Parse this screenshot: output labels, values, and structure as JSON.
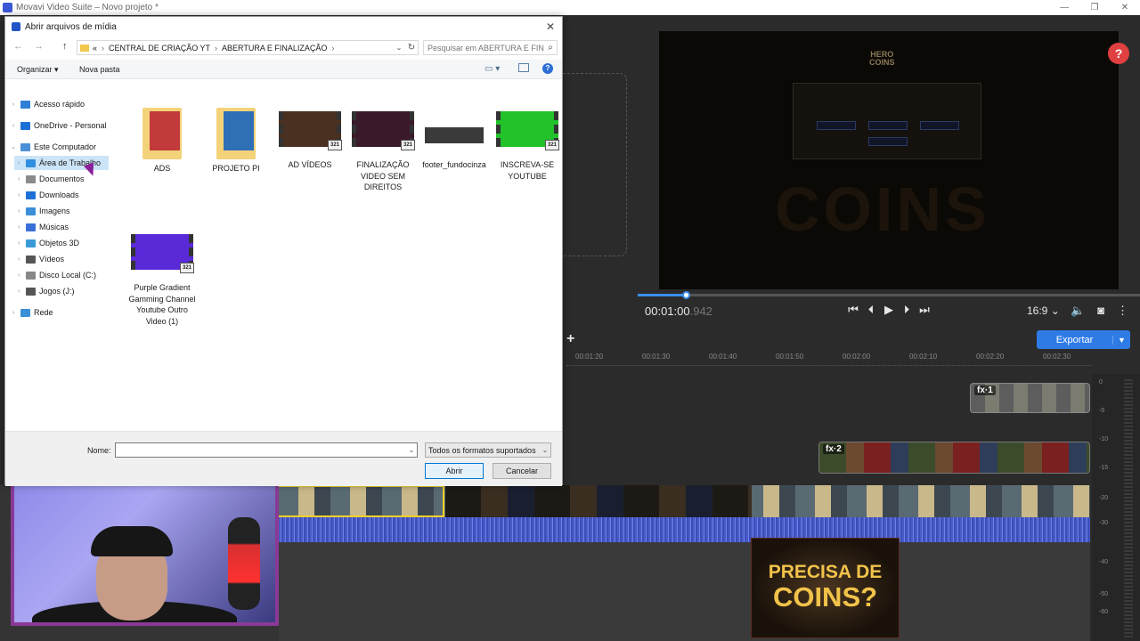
{
  "app": {
    "title": "Movavi Video Suite – Novo projeto *",
    "window_controls": [
      "—",
      "❐",
      "✕"
    ]
  },
  "dialog": {
    "title": "Abrir arquivos de mídia",
    "close": "✕",
    "nav": {
      "back": "←",
      "forward": "→",
      "up": "↑"
    },
    "breadcrumb": [
      "CENTRAL DE CRIAÇÃO YT",
      "ABERTURA E FINALIZAÇÃO"
    ],
    "breadcrumb_prefix": "«",
    "breadcrumb_sep": "›",
    "search_placeholder": "Pesquisar em ABERTURA E FIN...",
    "toolbar": {
      "organize": "Organizar ▾",
      "new_folder": "Nova pasta",
      "help": "?"
    },
    "nav_pane": [
      {
        "label": "Acesso rápido",
        "icon": "star-icon",
        "color": "#2f7fd6",
        "indent": 0,
        "chev": "›"
      },
      {
        "label": "OneDrive - Personal",
        "icon": "cloud-icon",
        "color": "#1d6fd8",
        "indent": 0,
        "chev": "›"
      },
      {
        "label": "Este Computador",
        "icon": "computer-icon",
        "color": "#4a90d9",
        "indent": 0,
        "chev": "⌄"
      },
      {
        "label": "Área de Trabalho",
        "icon": "desktop-icon",
        "color": "#2f8fe0",
        "indent": 1,
        "chev": "›",
        "selected": true
      },
      {
        "label": "Documentos",
        "icon": "documents-icon",
        "color": "#8a8a8a",
        "indent": 1,
        "chev": "›"
      },
      {
        "label": "Downloads",
        "icon": "download-icon",
        "color": "#1d6fd8",
        "indent": 1,
        "chev": "›"
      },
      {
        "label": "Imagens",
        "icon": "images-icon",
        "color": "#3a8fd8",
        "indent": 1,
        "chev": "›"
      },
      {
        "label": "Músicas",
        "icon": "music-icon",
        "color": "#3a6fd8",
        "indent": 1,
        "chev": "›"
      },
      {
        "label": "Objetos 3D",
        "icon": "cube-icon",
        "color": "#3a9ad8",
        "indent": 1,
        "chev": "›"
      },
      {
        "label": "Vídeos",
        "icon": "video-icon",
        "color": "#555",
        "indent": 1,
        "chev": "›"
      },
      {
        "label": "Disco Local (C:)",
        "icon": "drive-icon",
        "color": "#888",
        "indent": 1,
        "chev": "›"
      },
      {
        "label": "Jogos (J:)",
        "icon": "drive-icon",
        "color": "#555",
        "indent": 1,
        "chev": "›"
      },
      {
        "label": "Rede",
        "icon": "network-icon",
        "color": "#3a8fd8",
        "indent": 0,
        "chev": "›"
      }
    ],
    "files": [
      {
        "name": "ADS",
        "kind": "folder",
        "accent": "#c23a3a"
      },
      {
        "name": "PROJETO PI",
        "kind": "folder",
        "accent": "#2e6fb5"
      },
      {
        "name": "AD VÍDEOS",
        "kind": "video",
        "accent": "#4a3020"
      },
      {
        "name": "FINALIZAÇÃO VIDEO SEM DIREITOS",
        "kind": "video",
        "accent": "#3a1a2a"
      },
      {
        "name": "footer_fundocinza",
        "kind": "image",
        "accent": "#3a3a3a"
      },
      {
        "name": "INSCREVA-SE YOUTUBE",
        "kind": "video",
        "accent": "#22c22a"
      },
      {
        "name": "Purple Gradient Gamming Channel Youtube Outro Video (1)",
        "kind": "video",
        "accent": "#5a2ad8"
      }
    ],
    "video_badge": "321",
    "name_label": "Nome:",
    "name_value": "",
    "filter": "Todos os formatos suportados",
    "open_button": "Abrir",
    "cancel_button": "Cancelar"
  },
  "editor": {
    "timecode": "00:01:00",
    "timecode_ms": ".942",
    "playhead_fraction": 0.095,
    "aspect": "16:9 ⌄",
    "export_label": "Exportar",
    "add_track": "+",
    "help": "?",
    "ruler": [
      "00:01:20",
      "00:01:30",
      "00:01:40",
      "00:01:50",
      "00:02:00",
      "00:02:10",
      "00:02:20",
      "00:02:30"
    ],
    "meter_scale": [
      "0",
      "-5",
      "-10",
      "-15",
      "-20",
      "-30",
      "-40",
      "-50",
      "-60"
    ],
    "fx_labels": [
      "fx·1",
      "fx·2"
    ],
    "preview_logo": [
      "HERO",
      "COINS"
    ],
    "preview_bg_text": "COINS",
    "thumbnail_text": [
      "PRECISA DE",
      "COINS?"
    ]
  }
}
